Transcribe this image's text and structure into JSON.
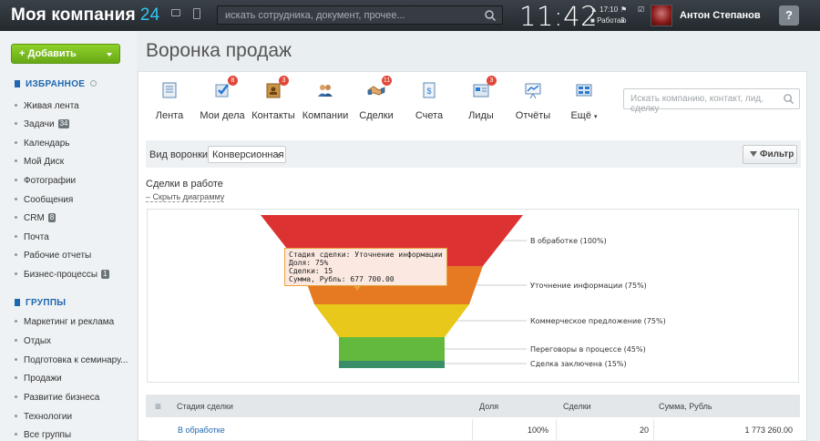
{
  "header": {
    "logo_text": "Моя компания",
    "logo_num": "24",
    "search_placeholder": "искать сотрудника, документ, прочее...",
    "time": "11:42",
    "alarm_time": "17:10",
    "task_count": "3",
    "work_status": "Работаю",
    "user_name": "Антон Степанов",
    "help_label": "?"
  },
  "sidebar": {
    "add_button": "+ Добавить",
    "favorites_title": "ИЗБРАННОЕ",
    "favorites": [
      {
        "label": "Живая лента",
        "badge": ""
      },
      {
        "label": "Задачи",
        "badge": "34"
      },
      {
        "label": "Календарь",
        "badge": ""
      },
      {
        "label": "Мой Диск",
        "badge": ""
      },
      {
        "label": "Фотографии",
        "badge": ""
      },
      {
        "label": "Сообщения",
        "badge": ""
      },
      {
        "label": "CRM",
        "badge": "8"
      },
      {
        "label": "Почта",
        "badge": ""
      },
      {
        "label": "Рабочие отчеты",
        "badge": ""
      },
      {
        "label": "Бизнес-процессы",
        "badge": "1"
      }
    ],
    "groups_title": "ГРУППЫ",
    "groups": [
      {
        "label": "Маркетинг и реклама"
      },
      {
        "label": "Отдых"
      },
      {
        "label": "Подготовка к семинару..."
      },
      {
        "label": "Продажи"
      },
      {
        "label": "Развитие бизнеса"
      },
      {
        "label": "Технологии"
      },
      {
        "label": "Все группы"
      }
    ]
  },
  "page_title": "Воронка продаж",
  "toolbar": {
    "items": [
      {
        "label": "Лента",
        "count": "",
        "icon": "feed-icon"
      },
      {
        "label": "Мои дела",
        "count": "8",
        "icon": "my-tasks-icon"
      },
      {
        "label": "Контакты",
        "count": "3",
        "icon": "contacts-icon"
      },
      {
        "label": "Компании",
        "count": "",
        "icon": "companies-icon"
      },
      {
        "label": "Сделки",
        "count": "11",
        "icon": "deals-icon"
      },
      {
        "label": "Счета",
        "count": "",
        "icon": "invoices-icon"
      },
      {
        "label": "Лиды",
        "count": "3",
        "icon": "leads-icon"
      },
      {
        "label": "Отчёты",
        "count": "",
        "icon": "reports-icon"
      },
      {
        "label": "Ещё",
        "count": "",
        "icon": "more-icon"
      }
    ],
    "search_placeholder": "Искать компанию, контакт, лид, сделку"
  },
  "filter_bar": {
    "label": "Вид воронки:",
    "selected": "Конверсионная",
    "filter_button": "Фильтр"
  },
  "deals_section": {
    "title": "Сделки в работе",
    "hide_link": "Скрыть диаграмму"
  },
  "chart_data": {
    "type": "funnel",
    "stages": [
      {
        "name": "В обработке",
        "percent": 100,
        "label": "В обработке (100%)",
        "color": "#dc3232"
      },
      {
        "name": "Уточнение информации",
        "percent": 75,
        "label": "Уточнение информации (75%)",
        "color": "#e57a22"
      },
      {
        "name": "Коммерческое предложение",
        "percent": 75,
        "label": "Коммерческое предложение (75%)",
        "color": "#e7c81b"
      },
      {
        "name": "Переговоры в процессе",
        "percent": 45,
        "label": "Переговоры в процессе (45%)",
        "color": "#62b93e"
      },
      {
        "name": "Сделка заключена",
        "percent": 15,
        "label": "Сделка заключена (15%)",
        "color": "#3a8f68"
      }
    ],
    "tooltip": {
      "line1": "Стадия сделки: Уточнение информации",
      "line2": "Доля: 75%",
      "line3": "Сделки: 15",
      "line4": "Сумма, Рубль: 677 700.00"
    }
  },
  "table": {
    "headers": [
      "Стадия сделки",
      "Доля",
      "Сделки",
      "Сумма, Рубль"
    ],
    "rows": [
      {
        "stage": "В обработке",
        "share": "100%",
        "deals": "20",
        "sum": "1 773 260.00"
      }
    ]
  }
}
